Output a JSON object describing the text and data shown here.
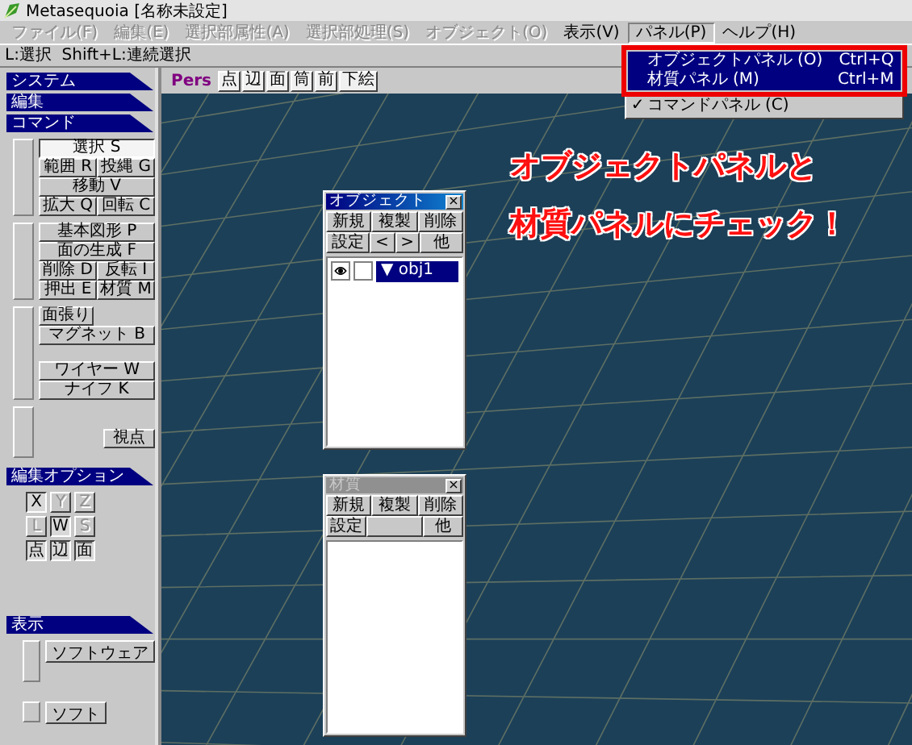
{
  "window": {
    "title": "Metasequoia [名称未設定]"
  },
  "menu_bar": [
    {
      "label": "ファイル(F)",
      "disabled": true,
      "selected": false
    },
    {
      "label": "編集(E)",
      "disabled": true,
      "selected": false
    },
    {
      "label": "選択部属性(A)",
      "disabled": true,
      "selected": false
    },
    {
      "label": "選択部処理(S)",
      "disabled": true,
      "selected": false
    },
    {
      "label": "オブジェクト(O)",
      "disabled": true,
      "selected": false
    },
    {
      "label": "表示(V)",
      "disabled": false,
      "selected": false
    },
    {
      "label": "パネル(P)",
      "disabled": false,
      "selected": true,
      "menu": [
        {
          "label": "オブジェクトパネル (O)",
          "shortcut": "Ctrl+Q",
          "highlighted": true,
          "checked": false
        },
        {
          "label": "材質パネル (M)",
          "shortcut": "Ctrl+M",
          "highlighted": true,
          "checked": false
        },
        {
          "label": "コマンドパネル (C)",
          "highlighted": false,
          "checked": true,
          "check_mark": "✓"
        }
      ]
    },
    {
      "label": "ヘルプ(H)",
      "disabled": false,
      "selected": false
    }
  ],
  "status_hint": "L:選択  Shift+L:連続選択",
  "sidebar": {
    "sections": [
      {
        "title": "システム"
      },
      {
        "title": "編集"
      },
      {
        "title": "コマンド",
        "groups": [
          {
            "blocks": [
              [
                [
                  {
                    "label": "選択 S",
                    "selected": true
                  }
                ],
                [
                  {
                    "label": "範囲 R",
                    "selected": false
                  },
                  {
                    "label": "投縄 G",
                    "selected": false
                  }
                ],
                [
                  {
                    "label": "移動 V",
                    "selected": false
                  }
                ],
                [
                  {
                    "label": "拡大 Q",
                    "selected": false
                  },
                  {
                    "label": "回転 C",
                    "selected": false
                  }
                ]
              ]
            ]
          },
          {
            "blocks": [
              [
                [
                  {
                    "label": "基本図形 P",
                    "selected": false
                  }
                ],
                [
                  {
                    "label": "面の生成 F",
                    "selected": false
                  }
                ],
                [
                  {
                    "label": "削除 D",
                    "selected": false
                  },
                  {
                    "label": "反転 I",
                    "selected": false
                  }
                ],
                [
                  {
                    "label": "押出 E",
                    "selected": false
                  },
                  {
                    "label": "材質 M",
                    "selected": false
                  }
                ]
              ]
            ]
          },
          {
            "blocks": [
              [
                [
                  {
                    "label": "面張り",
                    "selected": false
                  }
                ],
                [
                  {
                    "label": "マグネット B",
                    "selected": false
                  }
                ]
              ],
              [
                [
                  {
                    "label": "ワイヤー W",
                    "selected": false
                  }
                ],
                [
                  {
                    "label": "ナイフ K",
                    "selected": false
                  }
                ]
              ]
            ]
          },
          {
            "blocks": [
              [
                [
                  {
                    "label": "視点",
                    "selected": false
                  }
                ]
              ]
            ]
          }
        ]
      },
      {
        "title": "編集オプション",
        "toggles": [
          [
            {
              "label": "X",
              "on": true,
              "disabled": false
            },
            {
              "label": "Y",
              "on": false,
              "disabled": true
            },
            {
              "label": "Z",
              "on": false,
              "disabled": true
            }
          ],
          [
            {
              "label": "L",
              "on": false,
              "disabled": true
            },
            {
              "label": "W",
              "on": true,
              "disabled": false
            },
            {
              "label": "S",
              "on": false,
              "disabled": true
            }
          ],
          [
            {
              "label": "点",
              "on": true,
              "disabled": false
            },
            {
              "label": "辺",
              "on": true,
              "disabled": false
            },
            {
              "label": "面",
              "on": true,
              "disabled": false
            }
          ]
        ]
      },
      {
        "title": "表示",
        "buttons": [
          {
            "label": "ソフトウェア"
          },
          {
            "label": "ソフト"
          }
        ]
      }
    ]
  },
  "viewport": {
    "toolbar": [
      {
        "label": "Pers",
        "kind": "view"
      },
      {
        "label": "点",
        "kind": "button"
      },
      {
        "label": "辺",
        "kind": "button"
      },
      {
        "label": "面",
        "kind": "button"
      },
      {
        "label": "筒",
        "kind": "button"
      },
      {
        "label": "前",
        "kind": "button"
      },
      {
        "label": "下絵",
        "kind": "button"
      }
    ],
    "annotation": [
      "オブジェクトパネルと",
      "材質パネルにチェック！"
    ],
    "panels": [
      {
        "title": "オブジェクト",
        "close": "×",
        "active": true,
        "buttons": [
          [
            {
              "label": "新規"
            },
            {
              "label": "複製"
            },
            {
              "label": "削除"
            }
          ],
          [
            {
              "label": "設定"
            },
            {
              "label": "<"
            },
            {
              "label": ">"
            },
            {
              "label": "他"
            }
          ]
        ],
        "items": [
          {
            "name": "▼ obj1",
            "selected": true,
            "visible": true
          }
        ]
      },
      {
        "title": "材質",
        "close": "×",
        "active": false,
        "buttons": [
          [
            {
              "label": "新規"
            },
            {
              "label": "複製"
            },
            {
              "label": "削除"
            }
          ],
          [
            {
              "label": "設定"
            },
            {
              "kind": "blank"
            },
            {
              "label": "他"
            }
          ]
        ]
      }
    ]
  }
}
